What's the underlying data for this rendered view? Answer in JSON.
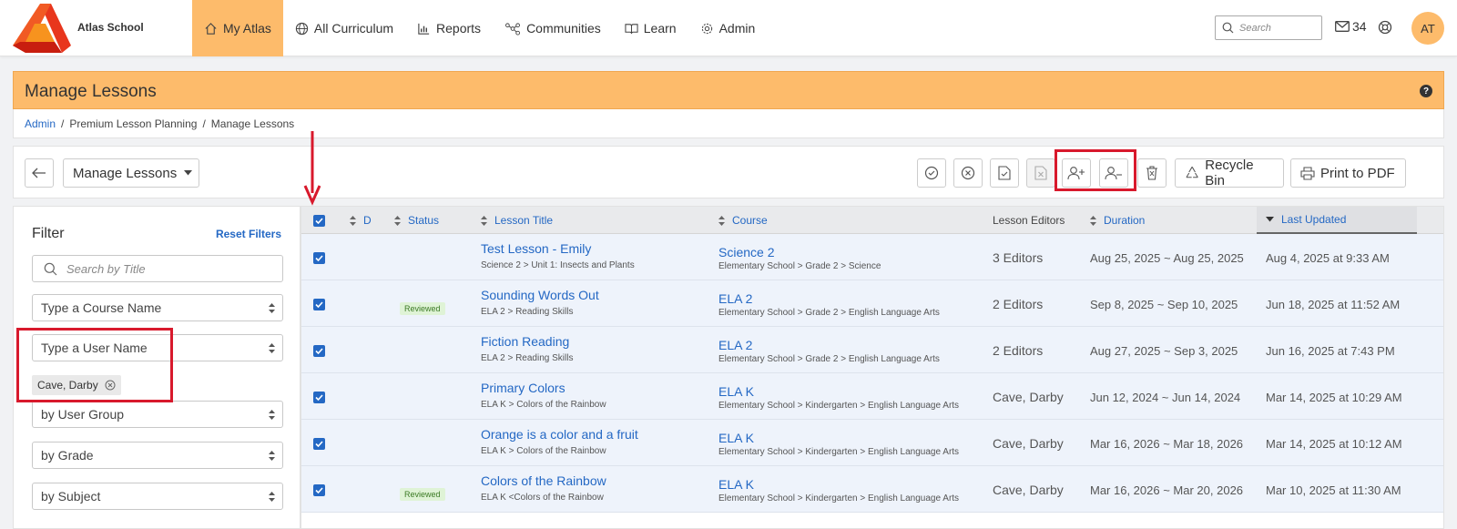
{
  "brand": {
    "school": "Atlas School"
  },
  "nav": [
    {
      "label": "My Atlas",
      "icon": "home-icon",
      "active": true
    },
    {
      "label": "All Curriculum",
      "icon": "globe-icon"
    },
    {
      "label": "Reports",
      "icon": "bar-chart-icon"
    },
    {
      "label": "Communities",
      "icon": "network-icon"
    },
    {
      "label": "Learn",
      "icon": "book-icon"
    },
    {
      "label": "Admin",
      "icon": "gear-icon"
    }
  ],
  "header": {
    "search_placeholder": "Search",
    "mail_count": "34",
    "avatar": "AT"
  },
  "page": {
    "title": "Manage Lessons",
    "help": "?"
  },
  "breadcrumb": {
    "root": "Admin",
    "mid": "Premium Lesson Planning",
    "current": "Manage Lessons"
  },
  "toolbar": {
    "select_label": "Manage Lessons",
    "recycle_label": "Recycle Bin",
    "print_label": "Print to PDF"
  },
  "filter": {
    "title": "Filter",
    "reset": "Reset Filters",
    "search_placeholder": "Search by Title",
    "course": "Type a Course Name",
    "user": "Type a User Name",
    "tag": "Cave, Darby",
    "group": "by User Group",
    "grade": "by Grade",
    "subject": "by Subject"
  },
  "table": {
    "columns": {
      "d": "D",
      "status": "Status",
      "title": "Lesson Title",
      "course": "Course",
      "editors": "Lesson Editors",
      "duration": "Duration",
      "updated": "Last Updated"
    },
    "rows": [
      {
        "title": "Test Lesson - Emily",
        "path": "Science 2 > Unit 1: Insects and Plants",
        "status": "",
        "course": "Science 2",
        "course_path": "Elementary School > Grade 2 > Science",
        "editors": "3 Editors",
        "duration": "Aug 25, 2025 ~ Aug 25, 2025",
        "updated": "Aug 4, 2025 at 9:33 AM"
      },
      {
        "title": "Sounding Words Out",
        "path": "ELA 2 > Reading Skills",
        "status": "Reviewed",
        "course": "ELA 2",
        "course_path": "Elementary School > Grade 2 > English Language Arts",
        "editors": "2 Editors",
        "duration": "Sep 8, 2025 ~ Sep 10, 2025",
        "updated": "Jun 18, 2025 at 11:52 AM"
      },
      {
        "title": "Fiction Reading",
        "path": "ELA 2 > Reading Skills",
        "status": "",
        "course": "ELA 2",
        "course_path": "Elementary School > Grade 2 > English Language Arts",
        "editors": "2 Editors",
        "duration": "Aug 27, 2025 ~ Sep 3, 2025",
        "updated": "Jun 16, 2025 at 7:43 PM"
      },
      {
        "title": "Primary Colors",
        "path": "ELA K > Colors of the Rainbow",
        "status": "",
        "course": "ELA K",
        "course_path": "Elementary School > Kindergarten > English Language Arts",
        "editors": "Cave, Darby",
        "duration": "Jun 12, 2024 ~ Jun 14, 2024",
        "updated": "Mar 14, 2025 at 10:29 AM"
      },
      {
        "title": "Orange is a color and a fruit",
        "path": "ELA K > Colors of the Rainbow",
        "status": "",
        "course": "ELA K",
        "course_path": "Elementary School > Kindergarten > English Language Arts",
        "editors": "Cave, Darby",
        "duration": "Mar 16, 2026 ~ Mar 18, 2026",
        "updated": "Mar 14, 2025 at 10:12 AM"
      },
      {
        "title": "Colors of the Rainbow",
        "path": "ELA K  <Colors of the Rainbow",
        "status": "Reviewed",
        "course": "ELA K",
        "course_path": "Elementary School > Kindergarten > English Language Arts",
        "editors": "Cave, Darby",
        "duration": "Mar 16, 2026 ~ Mar 20, 2026",
        "updated": "Mar 10, 2025 at 11:30 AM"
      }
    ]
  },
  "colors": {
    "accent": "#fdbb6b",
    "link": "#2468c4",
    "highlight": "#d8192c",
    "row_selected": "#eef3fb"
  }
}
